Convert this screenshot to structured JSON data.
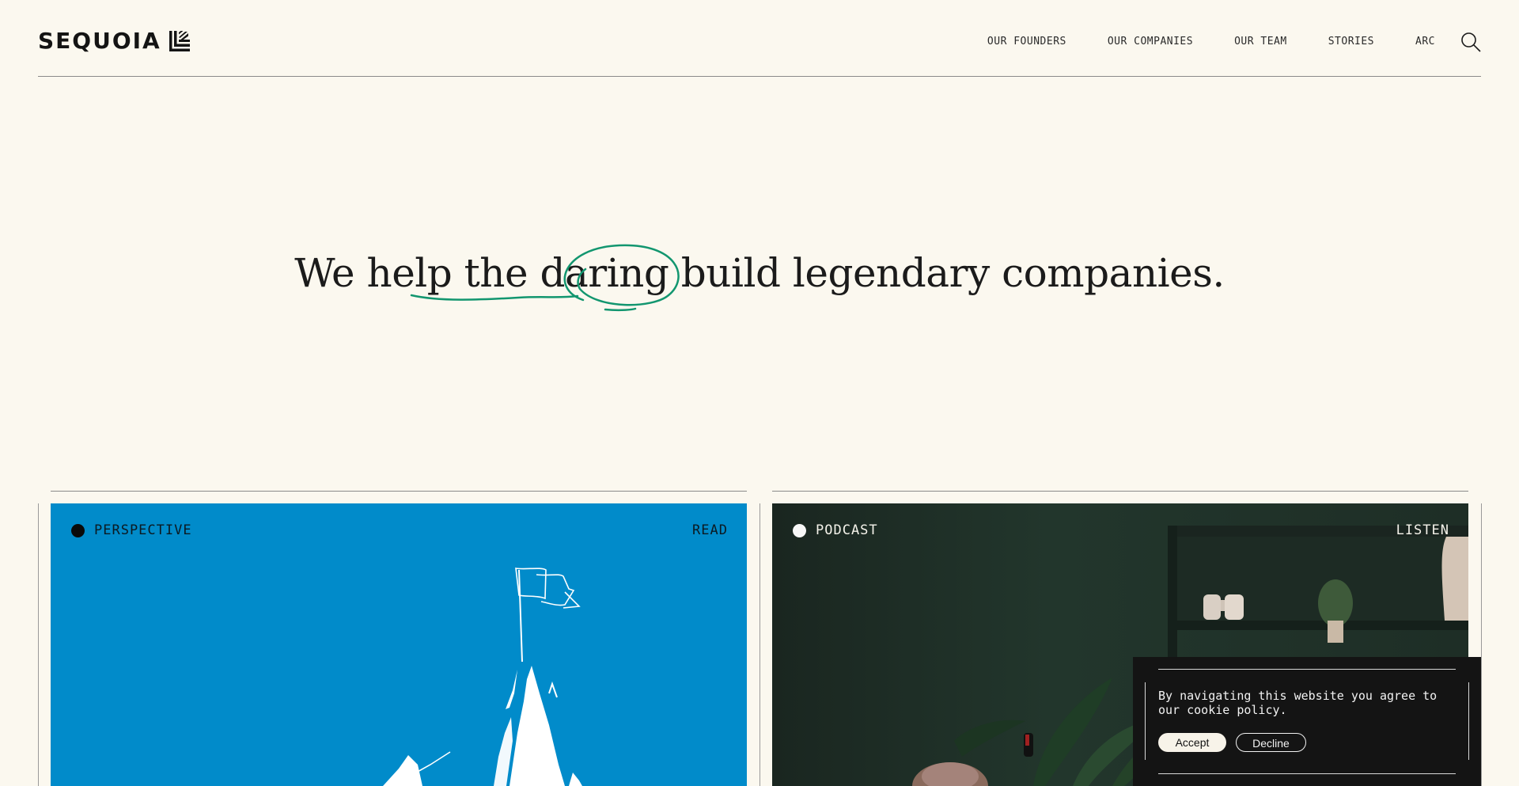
{
  "header": {
    "logo_text": "SEQUOIA",
    "nav": [
      {
        "label": "OUR FOUNDERS"
      },
      {
        "label": "OUR COMPANIES"
      },
      {
        "label": "OUR TEAM"
      },
      {
        "label": "STORIES"
      },
      {
        "label": "ARC"
      }
    ],
    "search_icon": "search-icon"
  },
  "hero": {
    "headline": "We help the daring build legendary companies.",
    "accent_color": "#12966f"
  },
  "cards": [
    {
      "tag": "PERSPECTIVE",
      "action": "READ",
      "background": "#018bca",
      "image": "mountain-flag-illustration"
    },
    {
      "tag": "PODCAST",
      "action": "LISTEN",
      "background": "#1f2c25",
      "image": "podcast-studio-photo"
    }
  ],
  "cookie": {
    "text": "By navigating this website you agree to our cookie policy.",
    "accept_label": "Accept",
    "decline_label": "Decline"
  },
  "colors": {
    "page_bg": "#fbf8ef",
    "text": "#1a1a1a",
    "cookie_bg": "#141414"
  }
}
